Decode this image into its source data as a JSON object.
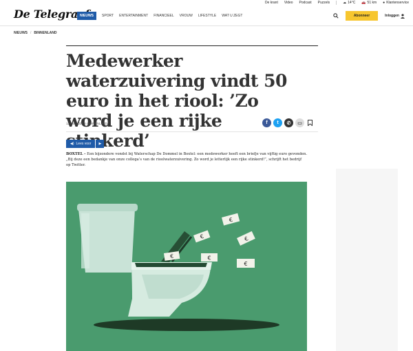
{
  "topbar": {
    "links": [
      "De krant",
      "Video",
      "Podcast",
      "Puzzels"
    ],
    "weather": "14°C",
    "traffic": "51 km",
    "service": "Klantenservice"
  },
  "logo": "De Telegraaf",
  "nav": [
    {
      "label": "NIEUWS",
      "active": true
    },
    {
      "label": "SPORT"
    },
    {
      "label": "ENTERTAINMENT"
    },
    {
      "label": "FINANCIEEL"
    },
    {
      "label": "VROUW"
    },
    {
      "label": "LIFESTYLE"
    },
    {
      "label": "WAT U ZEGT"
    }
  ],
  "actions": {
    "subscribe": "Abonneer",
    "login": "Inloggen"
  },
  "breadcrumb": [
    "NIEUWS",
    "BINNENLAND"
  ],
  "headline": "Medewerker waterzuivering vindt 50 euro in het riool: ’Zo word je een rijke stinkerd’",
  "meta": "12 okt. 2021 in BINNENLAND",
  "listen": "Lees voor",
  "intro": {
    "place": "BOXTEL - ",
    "text": "Een bijzondere vondst bij Waterschap De Dommel in Boxtel: een medewerker heeft een briefje van vijftig euro gevonden. „Bij deze een bedankje van onze collega’s van de rioolwaterzuivering. Zo word je letterlijk een rijke stinkerd!”, schrijft het bedrijf op Twitter."
  },
  "colors": {
    "accent": "#1f5ba8",
    "subscribe": "#f7c62f",
    "image_bg": "#4a9b6e"
  },
  "image": {
    "bills": [
      "€",
      "€",
      "€",
      "€",
      "€",
      "€"
    ]
  }
}
